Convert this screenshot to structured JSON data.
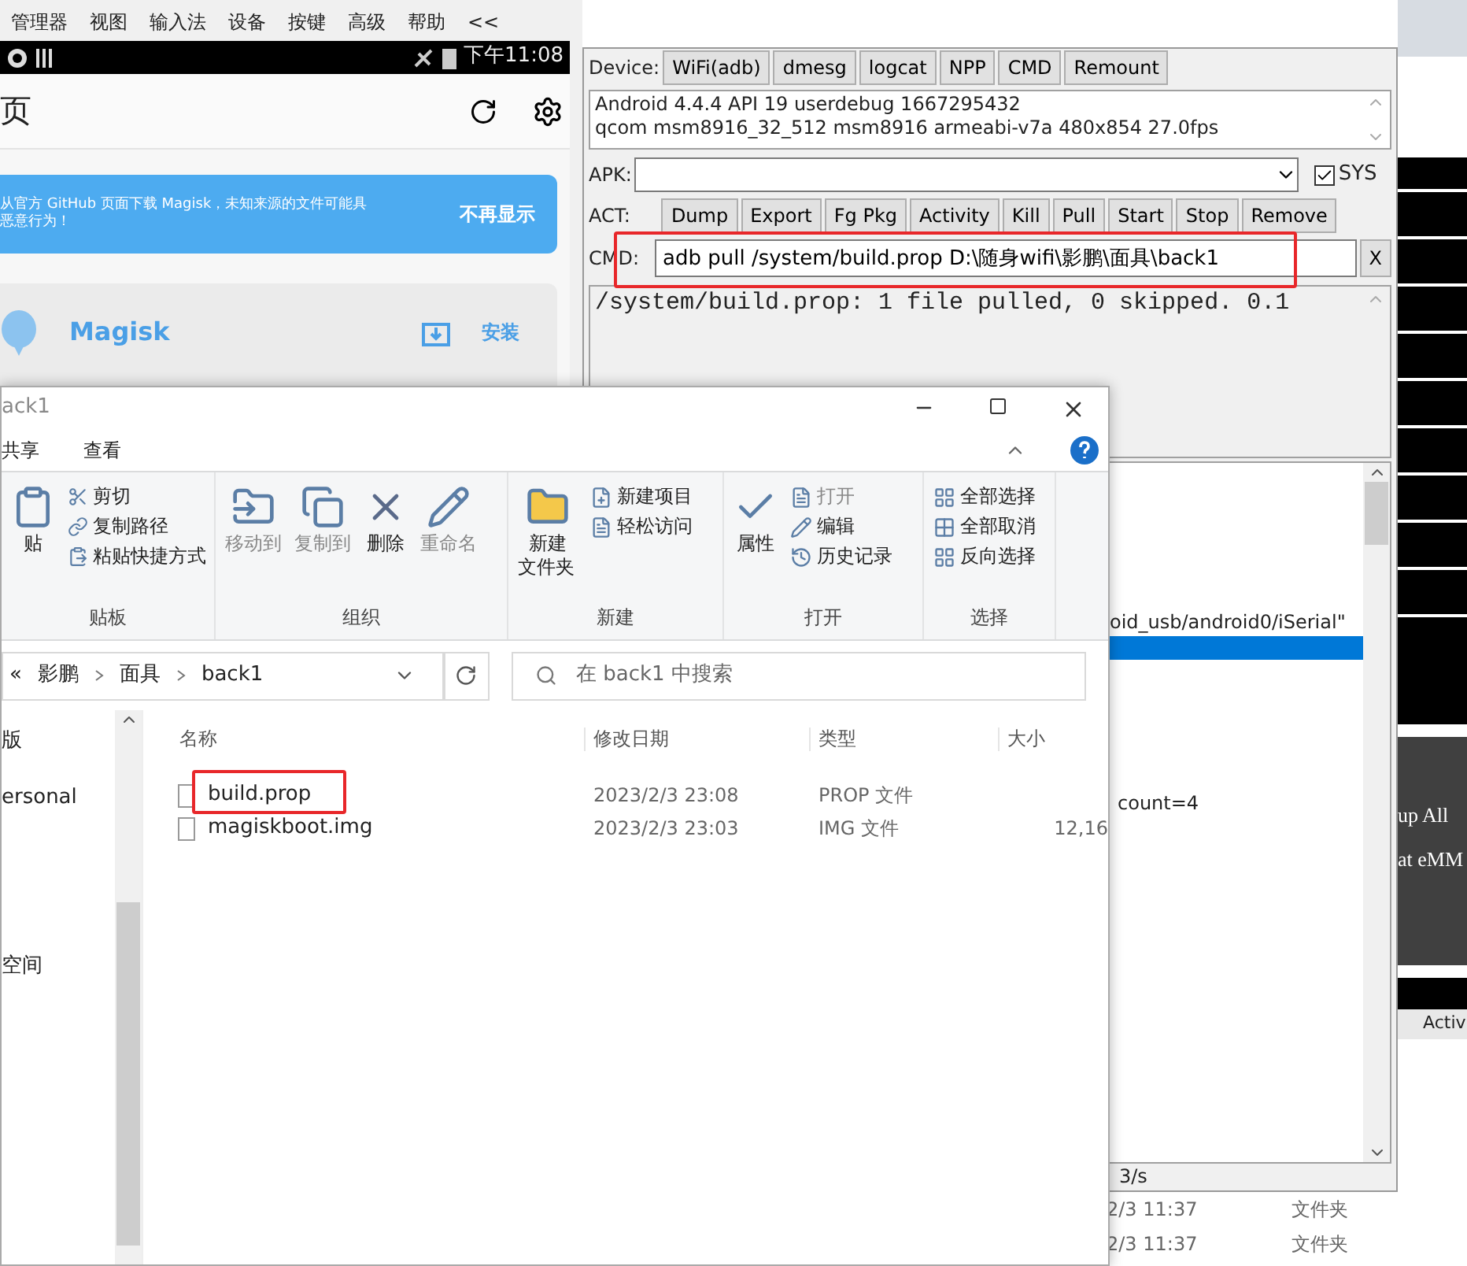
{
  "emulator": {
    "menu": [
      "管理器",
      "视图",
      "输入法",
      "设备",
      "按键",
      "高级",
      "帮助",
      "<<"
    ],
    "status_time": "下午11:08",
    "app_title": "页",
    "banner": {
      "lines": [
        "从官方 GitHub 页面下载 Magisk，未知来源的文件可能具",
        "恶意行为！"
      ],
      "action": "不再显示"
    },
    "card": {
      "title": "Magisk",
      "action": "安装"
    }
  },
  "tool": {
    "device_label": "Device:",
    "device_buttons": [
      "WiFi(adb)",
      "dmesg",
      "logcat",
      "NPP",
      "CMD",
      "Remount"
    ],
    "info_lines": [
      "Android 4.4.4 API 19 userdebug 1667295432",
      "qcom msm8916_32_512 msm8916 armeabi-v7a 480x854 27.0fps"
    ],
    "apk_label": "APK:",
    "sys": {
      "label": "SYS",
      "checked": true
    },
    "act_label": "ACT:",
    "act_buttons": [
      "Dump",
      "Export",
      "Fg Pkg",
      "Activity",
      "Kill",
      "Pull",
      "Start",
      "Stop",
      "Remove"
    ],
    "cmd_label": "CMD:",
    "cmd_value": "adb pull /system/build.prop D:\\随身wifi\\影鹏\\面具\\back1",
    "cmd_highlighted": true,
    "clear_button": "X",
    "output": "/system/build.prop: 1 file pulled, 0 skipped. 0.1",
    "log_top": "oid_usb/android0/iSerial\"",
    "log_selected_row": true,
    "log_bottom": "count=4",
    "status": "3/s"
  },
  "side_window": {
    "items": [
      "up All",
      "at eMM"
    ],
    "tab": "Activ"
  },
  "back_window": {
    "rows": [
      {
        "date": "2/3 11:37",
        "type": "文件夹"
      },
      {
        "date": "2/3 11:37",
        "type": "文件夹"
      }
    ]
  },
  "explorer": {
    "title": "ack1",
    "tabs": [
      "共享",
      "查看"
    ],
    "ribbon": [
      {
        "label": "贴板",
        "kind": "clipboard",
        "items": [
          "贴",
          "剪切",
          "复制路径",
          "粘贴快捷方式"
        ]
      },
      {
        "label": "组织",
        "kind": "organize",
        "items": [
          "移动到",
          "复制到",
          "删除",
          "重命名"
        ]
      },
      {
        "label": "新建",
        "kind": "new",
        "items": [
          "新建文件夹",
          "新建项目",
          "轻松访问"
        ]
      },
      {
        "label": "打开",
        "kind": "open",
        "items": [
          "属性",
          "打开",
          "编辑",
          "历史记录"
        ]
      },
      {
        "label": "选择",
        "kind": "select",
        "items": [
          "全部选择",
          "全部取消",
          "反向选择"
        ]
      }
    ],
    "path": [
      "«",
      "影鹏",
      "面具",
      "back1"
    ],
    "search_placeholder": "在 back1 中搜索",
    "nav": [
      "版",
      "ersonal",
      "空间"
    ],
    "columns": [
      "名称",
      "修改日期",
      "类型",
      "大小"
    ],
    "files": [
      {
        "name": "build.prop",
        "date": "2023/2/3 23:08",
        "type": "PROP 文件",
        "highlighted": true
      },
      {
        "name": "magiskboot.img",
        "date": "2023/2/3 23:03",
        "type": "IMG 文件",
        "size": "12,16",
        "highlighted": false
      }
    ]
  }
}
